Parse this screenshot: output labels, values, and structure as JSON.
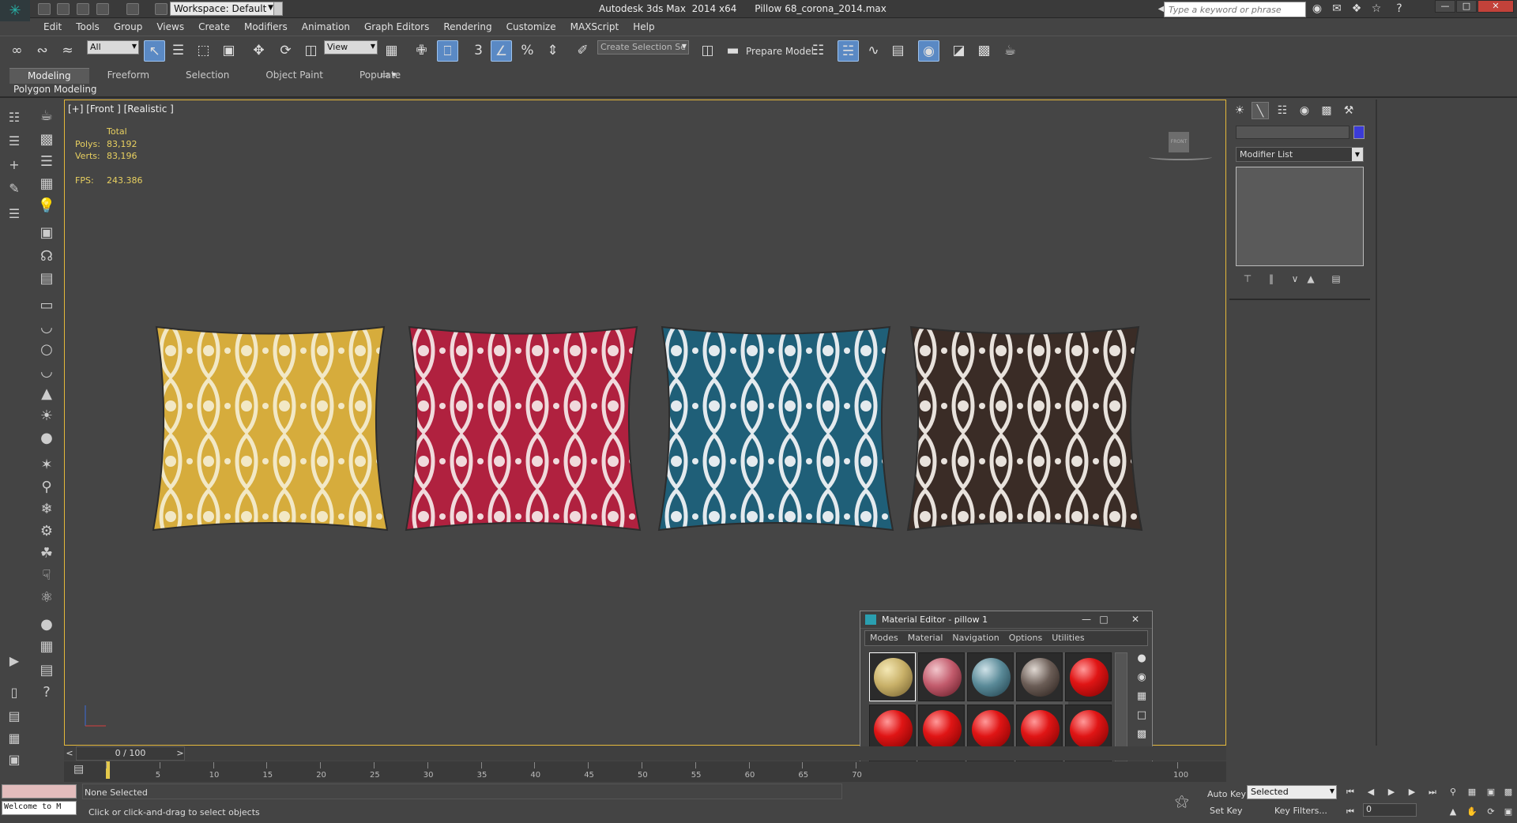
{
  "app": {
    "window_title": "Autodesk 3ds Max  2014 x64      Pillow 68_corona_2014.max",
    "workspace_label": "Workspace: Default",
    "search_placeholder": "Type a keyword or phrase"
  },
  "menu": [
    "Edit",
    "Tools",
    "Group",
    "Views",
    "Create",
    "Modifiers",
    "Animation",
    "Graph Editors",
    "Rendering",
    "Customize",
    "MAXScript",
    "Help"
  ],
  "toolbar": {
    "selection_filter": "All",
    "ref_coord": "View",
    "selection_set_placeholder": "Create Selection Se",
    "prepare_model_label": "Prepare Model"
  },
  "ribbon": {
    "tabs": [
      "Modeling",
      "Freeform",
      "Selection",
      "Object Paint",
      "Populate"
    ],
    "active_tab": "Modeling",
    "panel_label": "Polygon Modeling"
  },
  "viewport": {
    "label": "[+] [Front ] [Realistic ]",
    "stats": {
      "header": "Total",
      "polys_label": "Polys:",
      "polys_value": "83,192",
      "verts_label": "Verts:",
      "verts_value": "83,196",
      "fps_label": "FPS:",
      "fps_value": "243.386"
    },
    "viewcube_label": "FRONT",
    "pillows": [
      {
        "name": "yellow",
        "base": "#d6ac3c",
        "pattern": "#f2e8c6"
      },
      {
        "name": "red",
        "base": "#b0213f",
        "pattern": "#f0dadc"
      },
      {
        "name": "teal",
        "base": "#1f5f78",
        "pattern": "#e4eaee"
      },
      {
        "name": "brown",
        "base": "#3a2c26",
        "pattern": "#e8e2dc"
      }
    ]
  },
  "material_editor": {
    "title": "Material Editor - pillow 1",
    "menus": [
      "Modes",
      "Material",
      "Navigation",
      "Options",
      "Utilities"
    ],
    "slots_row1": [
      "pillow-yellow",
      "pillow-red",
      "pillow-teal",
      "pillow-brown",
      "default-red"
    ],
    "slot_colors": {
      "default": "#e01515",
      "yellow": "#c8b068",
      "red": "#c25b6c",
      "teal": "#5a8a98",
      "brown": "#6b5d56"
    }
  },
  "command_panel": {
    "modifier_list_label": "Modifier List",
    "object_color": "#3b3bd8"
  },
  "timeline": {
    "slider_label": "0 / 100",
    "ticks": [
      "0",
      "5",
      "10",
      "15",
      "20",
      "25",
      "30",
      "35",
      "40",
      "45",
      "50",
      "55",
      "60",
      "65",
      "70",
      "100"
    ]
  },
  "status": {
    "listener_text": "Welcome to M",
    "selection_status": "None Selected",
    "prompt": "Click or click-and-drag to select objects",
    "auto_key_label": "Auto Key",
    "set_key_label": "Set Key",
    "selected_dd": "Selected",
    "key_filters_label": "Key Filters...",
    "current_frame": "0"
  }
}
